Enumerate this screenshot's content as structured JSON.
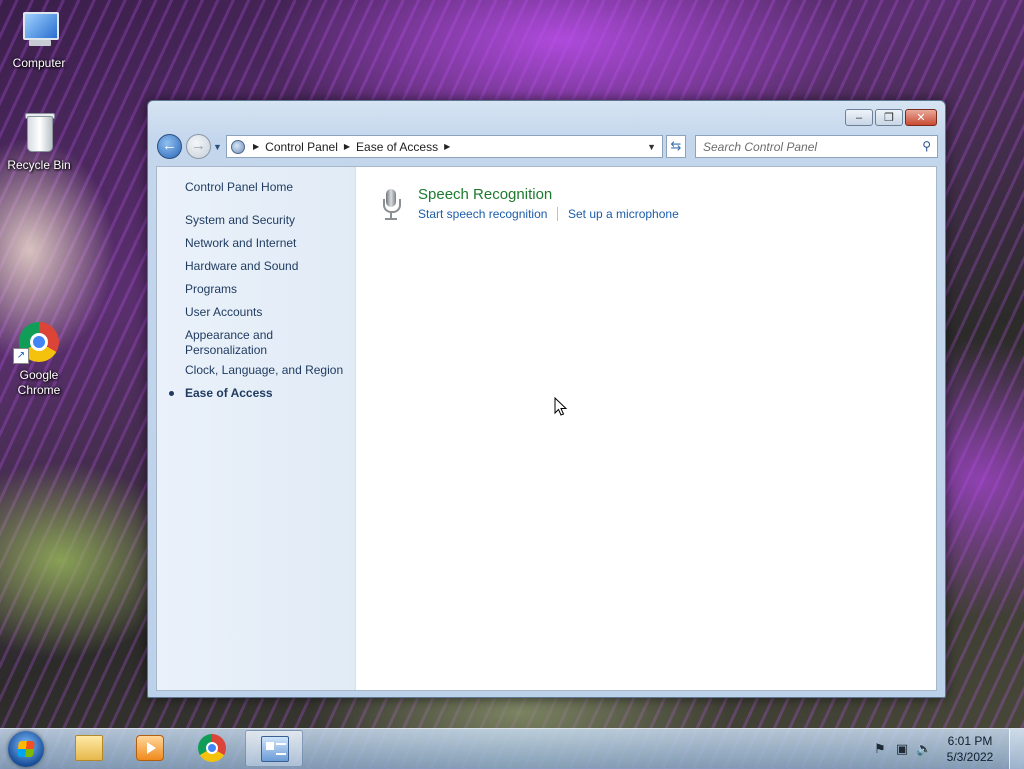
{
  "desktop": {
    "icons": [
      {
        "label": "Computer"
      },
      {
        "label": "Recycle Bin"
      },
      {
        "label": "Google Chrome"
      }
    ]
  },
  "window": {
    "controls": {
      "minimize": "–",
      "maximize": "❐",
      "close": "✕"
    },
    "breadcrumb": [
      "Control Panel",
      "Ease of Access"
    ],
    "search": {
      "placeholder": "Search Control Panel"
    },
    "sidebar": {
      "home": "Control Panel Home",
      "items": [
        "System and Security",
        "Network and Internet",
        "Hardware and Sound",
        "Programs",
        "User Accounts",
        "Appearance and Personalization",
        "Clock, Language, and Region",
        "Ease of Access"
      ],
      "active": "Ease of Access"
    },
    "content": {
      "category": {
        "title": "Speech Recognition",
        "icon": "microphone-icon",
        "tasks": [
          "Start speech recognition",
          "Set up a microphone"
        ]
      }
    }
  },
  "taskbar": {
    "pinned": [
      "windows-explorer-icon",
      "media-player-icon",
      "chrome-icon",
      "control-panel-icon"
    ],
    "active": "control-panel-icon",
    "tray": [
      "action-center-flag-icon",
      "network-icon",
      "volume-icon"
    ],
    "clock": {
      "time": "6:01 PM",
      "date": "5/3/2022"
    }
  },
  "colors": {
    "link": "#1c5ca9",
    "category_title": "#1e7a2e",
    "sidebar_bg": "#e6eef8"
  }
}
